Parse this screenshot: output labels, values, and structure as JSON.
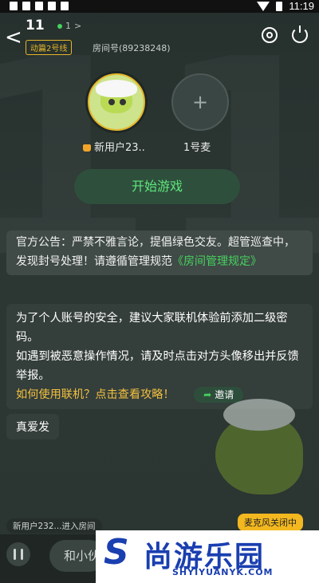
{
  "status_bar": {
    "time": "11:19"
  },
  "header": {
    "back": "<",
    "room_number": "11",
    "online_count": "1",
    "online_arrow": ">",
    "line_tag": "动篇2号线",
    "room_id": "房间号(89238248)"
  },
  "seats": [
    {
      "label": "新用户23..",
      "occupied": true
    },
    {
      "label": "1号麦",
      "occupied": false,
      "plus": "+"
    }
  ],
  "start_button": "开始游戏",
  "notice": {
    "text": "官方公告：严禁不雅言论，提倡绿色交友。超管巡查中，发现封号处理！请遵循管理规范",
    "link": "《房间管理规定》"
  },
  "tip": {
    "line1": "为了个人账号的安全，建议大家联机体验前添加二级密码。",
    "line2": "如遇到被恶意操作情况，请及时点击对方头像移出并反馈举报。",
    "guide": "如何使用联机？点击查看攻略！",
    "invite": "邀请",
    "invite_arrow": "➦"
  },
  "message": "真爱发",
  "entry_notice": "新用户232...进入房间",
  "mic_status": "麦克风关闭中",
  "input_placeholder": "和小伙",
  "watermark": {
    "logo": "S",
    "title": "尚游乐园",
    "subtitle": "SHYIYUANYK.COM"
  },
  "colors": {
    "accent_green": "#46d15e",
    "accent_yellow": "#e6b62a"
  }
}
